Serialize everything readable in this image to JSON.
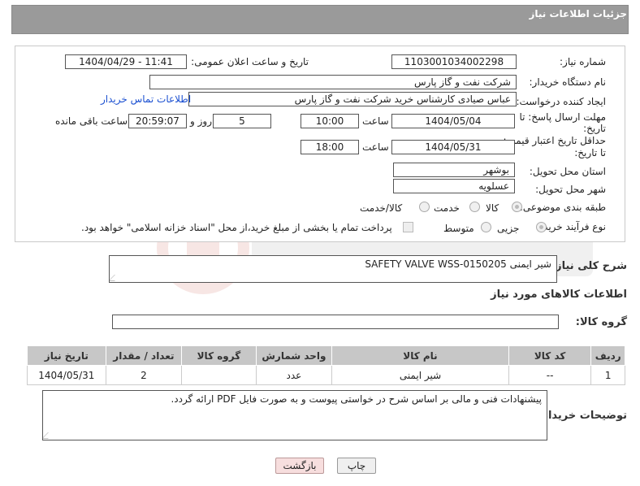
{
  "header": {
    "title": "جزئیات اطلاعات نیاز"
  },
  "form": {
    "need_number_label": "شماره نیاز:",
    "need_number": "1103001034002298",
    "announce_label": "تاریخ و ساعت اعلان عمومی:",
    "announce_value": "1404/04/29 - 11:41",
    "buyer_org_label": "نام دستگاه خریدار:",
    "buyer_org": "شرکت نفت و گاز پارس",
    "creator_label": "ایجاد کننده درخواست:",
    "creator": "عباس صیادی کارشناس خرید شرکت نفت و گاز پارس",
    "contact_link": "اطلاعات تماس خریدار",
    "deadline_label_1": "مهلت ارسال پاسخ: تا",
    "deadline_label_2": "تاریخ:",
    "deadline_date": "1404/05/04",
    "time_label": "ساعت",
    "deadline_time": "10:00",
    "days_value": "5",
    "days_label": "روز و",
    "remaining_time": "20:59:07",
    "remaining_label": "ساعت باقی مانده",
    "validity_label_1": "حداقل تاریخ اعتبار قیمت:",
    "validity_label_2": "تا تاریخ:",
    "validity_date": "1404/05/31",
    "validity_time": "18:00",
    "province_label": "استان محل تحویل:",
    "province": "بوشهر",
    "city_label": "شهر محل تحویل:",
    "city": "عسلویه",
    "category_label": "طبقه بندی موضوعی:",
    "category_options": [
      "کالا",
      "خدمت",
      "کالا/خدمت"
    ],
    "process_label": "نوع فرآیند خرید :",
    "process_options": [
      "جزیی",
      "متوسط"
    ],
    "payment_note": "پرداخت تمام یا بخشی از مبلغ خرید،از محل \"اسناد خزانه اسلامی\" خواهد بود."
  },
  "description": {
    "label": "شرح کلی نیاز:",
    "value": "شیر ایمنی SAFETY VALVE WSS-0150205"
  },
  "goods": {
    "section_title": "اطلاعات کالاهای مورد نیاز",
    "group_label": "گروه کالا:",
    "group_value": "",
    "columns": [
      "ردیف",
      "کد کالا",
      "نام کالا",
      "واحد شمارش",
      "گروه کالا",
      "تعداد / مقدار",
      "تاریخ نیاز"
    ],
    "rows": [
      [
        "1",
        "--",
        "شیر ایمنی",
        "عدد",
        "",
        "2",
        "1404/05/31"
      ]
    ]
  },
  "buyer_notes": {
    "label": "توضیحات خریدار:",
    "value": "پیشنهادات فنی و مالی بر اساس شرح در خواستی پیوست و به صورت فایل PDF ارائه گردد."
  },
  "buttons": {
    "print": "چاپ",
    "back": "بازگشت"
  },
  "colors": {
    "header_bg": "#9a9a9a",
    "link": "#1a4fd1",
    "table_header": "#c7c7c7",
    "back_button": "#f7dede"
  }
}
